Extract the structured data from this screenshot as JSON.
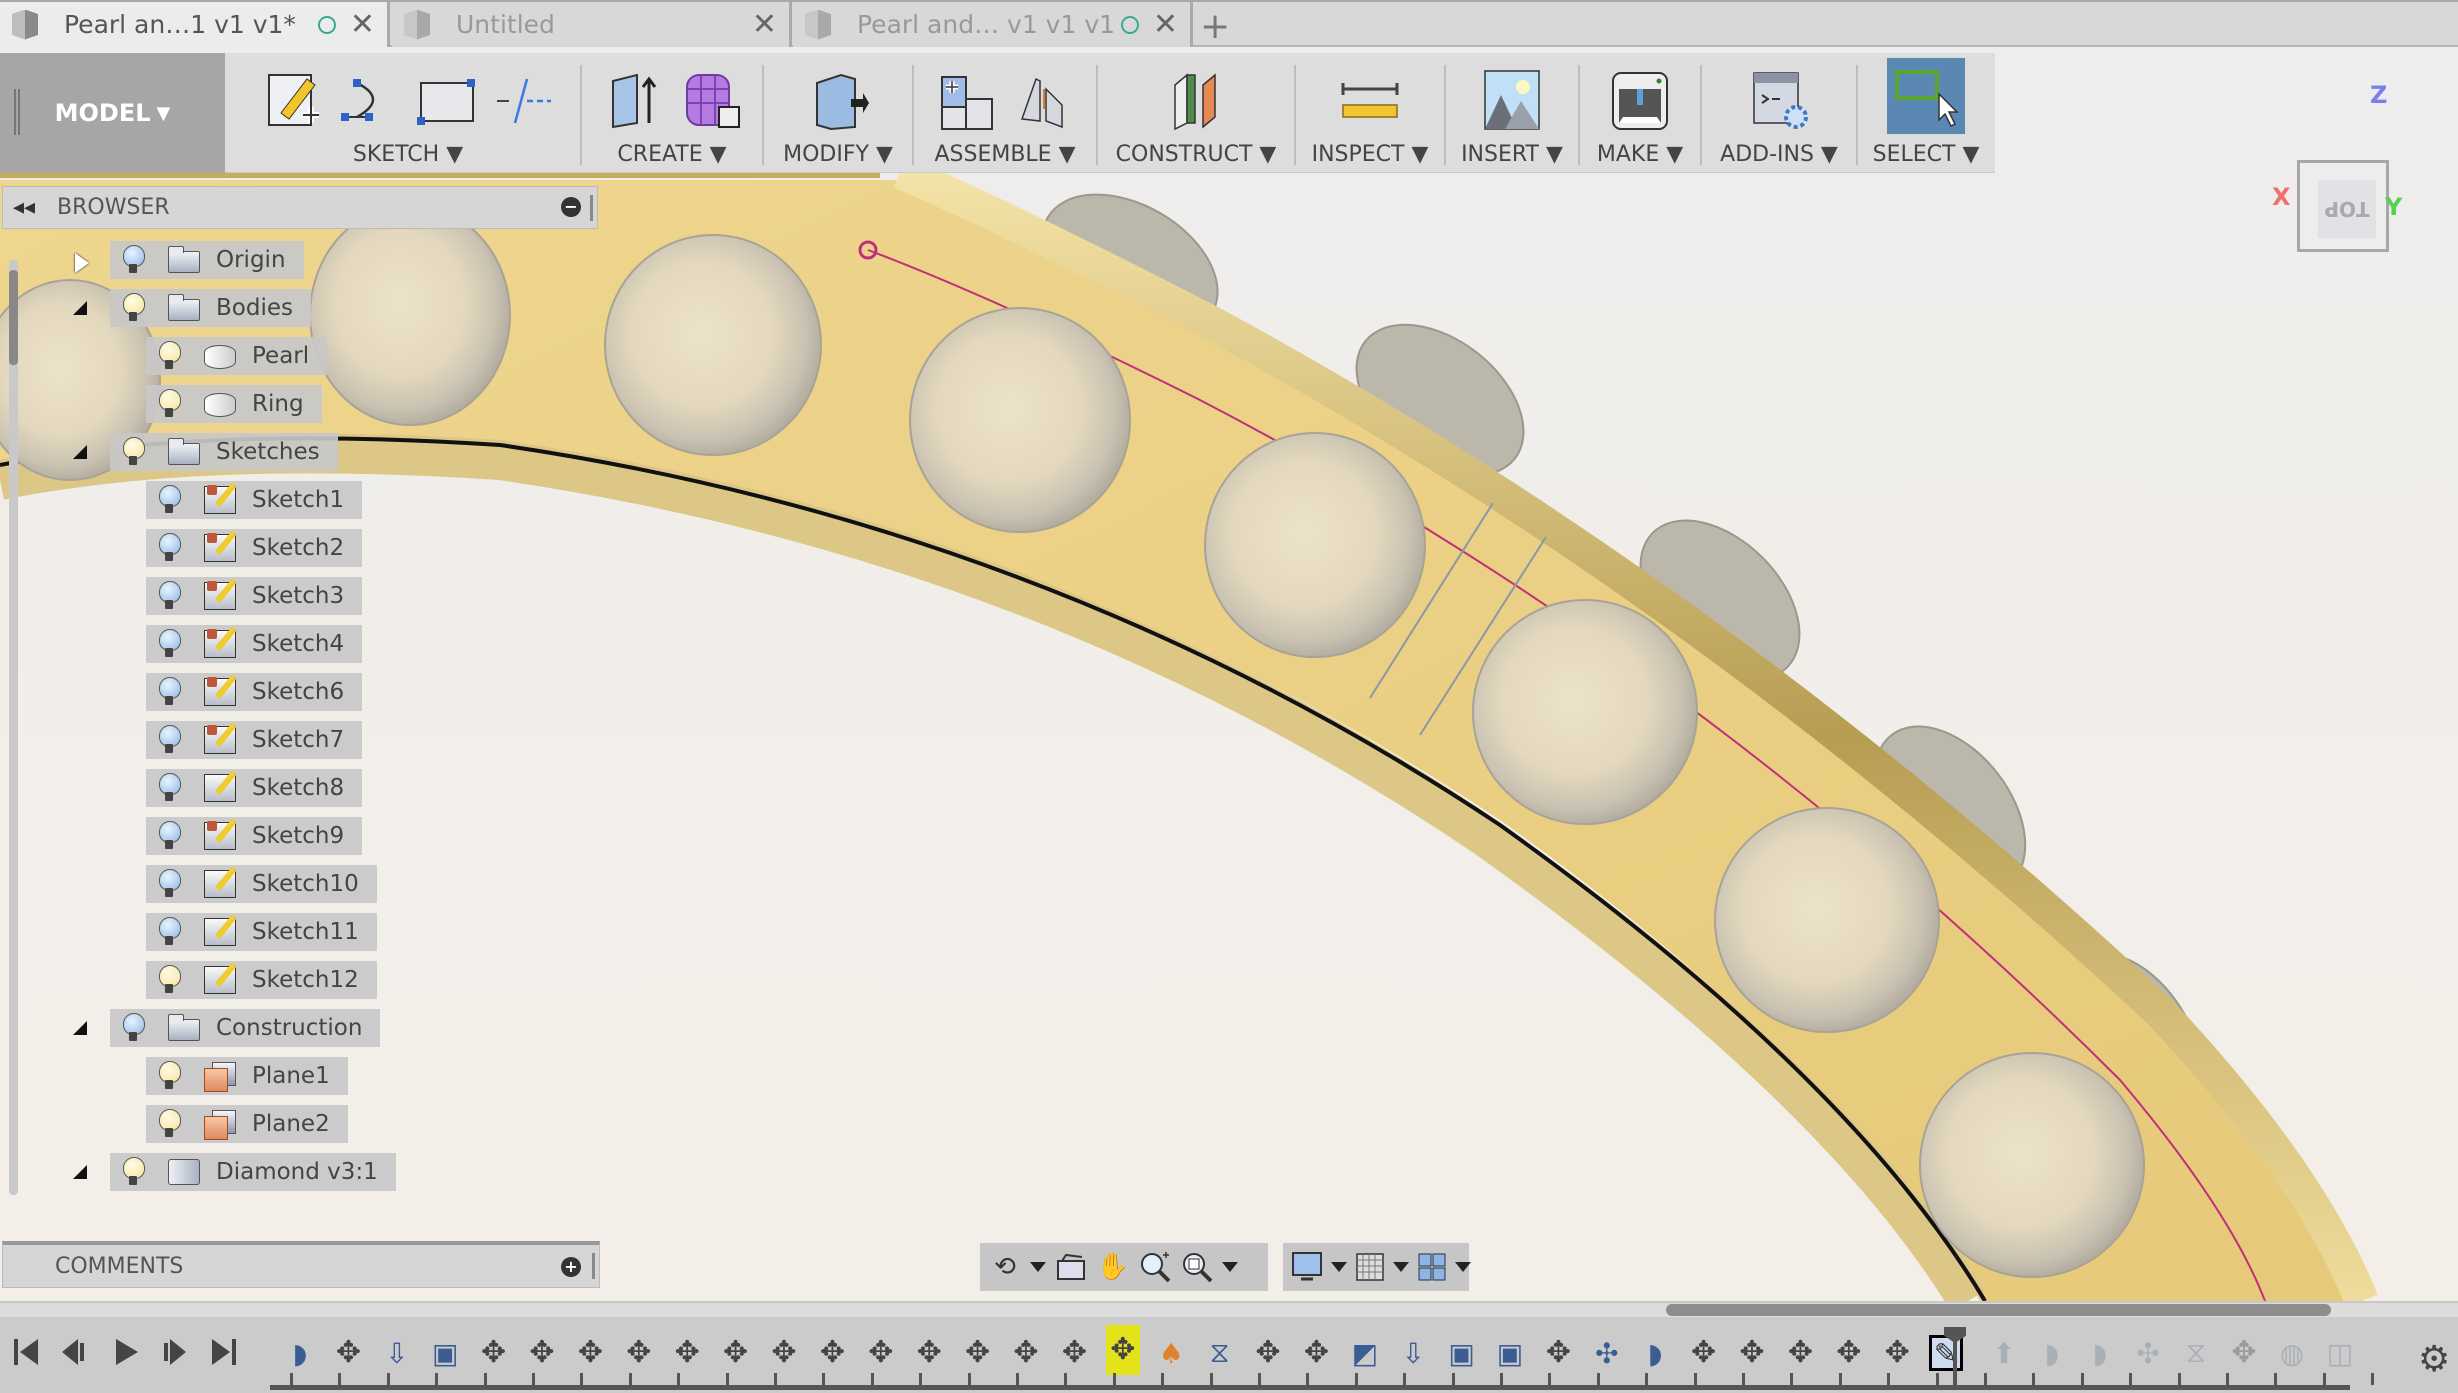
{
  "tabs": [
    {
      "title": "Pearl an…1 v1 v1*",
      "active": true,
      "saved_indicator": true
    },
    {
      "title": "Untitled",
      "active": false,
      "saved_indicator": false
    },
    {
      "title": "Pearl and… v1 v1 v1",
      "active": false,
      "saved_indicator": true
    }
  ],
  "new_tab_label": "+",
  "close_glyph": "✕",
  "toolbar": {
    "workspace": "MODEL",
    "groups": [
      {
        "label": "SKETCH",
        "icons": [
          "create-sketch-icon",
          "arc-icon",
          "rectangle-icon",
          "construction-line-icon"
        ]
      },
      {
        "label": "CREATE",
        "icons": [
          "extrude-icon",
          "form-icon"
        ]
      },
      {
        "label": "MODIFY",
        "icons": [
          "press-pull-icon"
        ]
      },
      {
        "label": "ASSEMBLE",
        "icons": [
          "new-component-icon",
          "joint-icon"
        ]
      },
      {
        "label": "CONSTRUCT",
        "icons": [
          "offset-plane-icon"
        ]
      },
      {
        "label": "INSPECT",
        "icons": [
          "measure-icon"
        ]
      },
      {
        "label": "INSERT",
        "icons": [
          "insert-image-icon"
        ]
      },
      {
        "label": "MAKE",
        "icons": [
          "3d-print-icon"
        ]
      },
      {
        "label": "ADD-INS",
        "icons": [
          "scripts-addins-icon"
        ]
      },
      {
        "label": "SELECT",
        "icons": [
          "window-select-icon"
        ]
      }
    ],
    "dropdown_glyph": "▼"
  },
  "browser": {
    "title": "BROWSER",
    "collapse_glyph": "◂◂",
    "minimize_glyph": "−",
    "nodes": [
      {
        "label": "Origin",
        "type": "folder",
        "visible": false,
        "level": 0,
        "expander": "closed"
      },
      {
        "label": "Bodies",
        "type": "folder",
        "visible": true,
        "level": 0,
        "expander": "open"
      },
      {
        "label": "Pearl",
        "type": "body",
        "visible": true,
        "level": 1
      },
      {
        "label": "Ring",
        "type": "body",
        "visible": true,
        "level": 1
      },
      {
        "label": "Sketches",
        "type": "folder",
        "visible": true,
        "level": 0,
        "expander": "open"
      },
      {
        "label": "Sketch1",
        "type": "sketch",
        "visible": false,
        "level": 1,
        "pinned": true
      },
      {
        "label": "Sketch2",
        "type": "sketch",
        "visible": false,
        "level": 1,
        "pinned": true
      },
      {
        "label": "Sketch3",
        "type": "sketch",
        "visible": false,
        "level": 1,
        "pinned": true
      },
      {
        "label": "Sketch4",
        "type": "sketch",
        "visible": false,
        "level": 1,
        "pinned": true
      },
      {
        "label": "Sketch6",
        "type": "sketch",
        "visible": false,
        "level": 1,
        "pinned": true
      },
      {
        "label": "Sketch7",
        "type": "sketch",
        "visible": false,
        "level": 1,
        "pinned": true
      },
      {
        "label": "Sketch8",
        "type": "sketch",
        "visible": false,
        "level": 1,
        "pinned": false
      },
      {
        "label": "Sketch9",
        "type": "sketch",
        "visible": false,
        "level": 1,
        "pinned": true
      },
      {
        "label": "Sketch10",
        "type": "sketch",
        "visible": false,
        "level": 1,
        "pinned": false
      },
      {
        "label": "Sketch11",
        "type": "sketch",
        "visible": false,
        "level": 1,
        "pinned": false
      },
      {
        "label": "Sketch12",
        "type": "sketch",
        "visible": true,
        "level": 1,
        "pinned": false
      },
      {
        "label": "Construction",
        "type": "folder",
        "visible": false,
        "level": 0,
        "expander": "open"
      },
      {
        "label": "Plane1",
        "type": "plane",
        "visible": true,
        "level": 1
      },
      {
        "label": "Plane2",
        "type": "plane",
        "visible": true,
        "level": 1
      },
      {
        "label": "Diamond v3:1",
        "type": "component",
        "visible": true,
        "level": 0,
        "expander": "open"
      }
    ]
  },
  "comments": {
    "title": "COMMENTS",
    "add_glyph": "+"
  },
  "viewcube": {
    "face": "TOP",
    "axes": {
      "x": "X",
      "y": "Y",
      "z": "Z"
    }
  },
  "navbar": {
    "left": [
      "orbit-icon",
      "look-at-icon",
      "pan-icon",
      "zoom-icon",
      "fit-icon"
    ],
    "right": [
      "display-settings-icon",
      "grid-settings-icon",
      "viewports-icon"
    ]
  },
  "timeline": {
    "playback": [
      "go-to-start",
      "step-back",
      "play",
      "step-forward",
      "go-to-end"
    ],
    "items": [
      "fillet",
      "move",
      "derive",
      "sketch-plane",
      "move",
      "move",
      "move",
      "move",
      "move",
      "move",
      "move",
      "move",
      "move",
      "move",
      "move",
      "move",
      "move",
      "move-selected",
      "fillet-orange",
      "mirror",
      "move",
      "move",
      "shell",
      "derive",
      "sketch-plane",
      "sketch-plane",
      "move",
      "pattern",
      "fillet",
      "move",
      "move",
      "move",
      "move",
      "move",
      "sketch-active"
    ],
    "suppressed_items": [
      "extrude",
      "fillet",
      "fillet",
      "pattern",
      "mirror",
      "move",
      "form",
      "combine"
    ],
    "settings_glyph": "⚙"
  },
  "colors": {
    "ring_gold": "#e8cd82",
    "sketch_path": "#c0307a",
    "select_active": "#5b87b3"
  }
}
